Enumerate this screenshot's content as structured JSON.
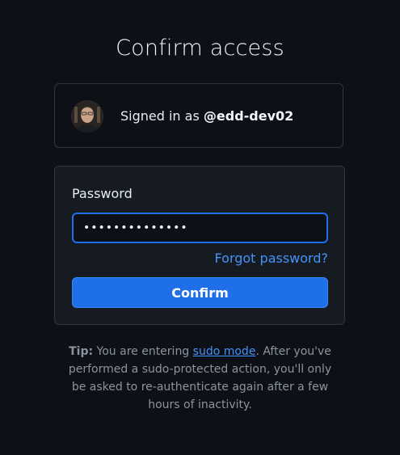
{
  "page": {
    "title": "Confirm access"
  },
  "account": {
    "signed_in_prefix": "Signed in as",
    "username": "@edd-dev02",
    "avatar_icon": "user-avatar-photo"
  },
  "form": {
    "password_label": "Password",
    "password_value": "••••••••••••••",
    "forgot_password_link": "Forgot password?",
    "confirm_button": "Confirm"
  },
  "tip": {
    "label": "Tip:",
    "text_before_link": "You are entering",
    "link_text": "sudo mode",
    "text_after_link": ". After you've performed a sudo-protected action, you'll only be asked to re-authenticate again after a few hours of inactivity."
  },
  "colors": {
    "background": "#0d1117",
    "card_background": "#161b22",
    "border": "#30363d",
    "accent_blue": "#1f6feb",
    "link_blue": "#4493f8",
    "muted_text": "#8b949e"
  }
}
